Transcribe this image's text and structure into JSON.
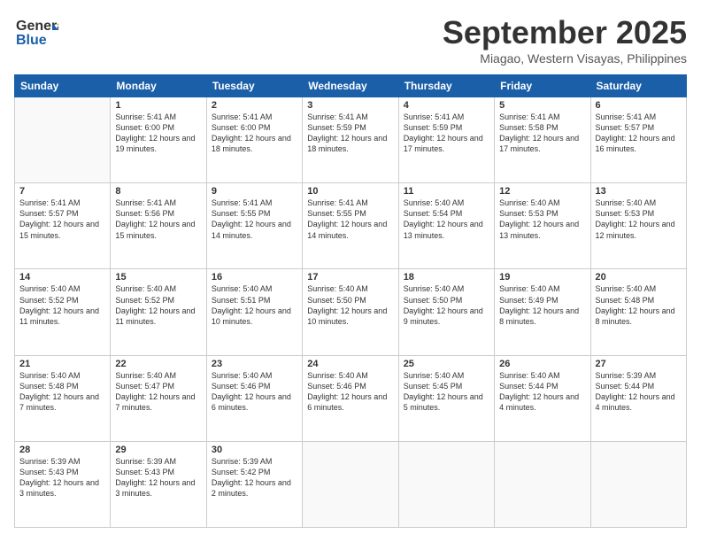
{
  "logo": {
    "line1": "General",
    "line2": "Blue"
  },
  "header": {
    "month": "September 2025",
    "location": "Miagao, Western Visayas, Philippines"
  },
  "weekdays": [
    "Sunday",
    "Monday",
    "Tuesday",
    "Wednesday",
    "Thursday",
    "Friday",
    "Saturday"
  ],
  "weeks": [
    [
      {
        "day": "",
        "sunrise": "",
        "sunset": "",
        "daylight": ""
      },
      {
        "day": "1",
        "sunrise": "Sunrise: 5:41 AM",
        "sunset": "Sunset: 6:00 PM",
        "daylight": "Daylight: 12 hours and 19 minutes."
      },
      {
        "day": "2",
        "sunrise": "Sunrise: 5:41 AM",
        "sunset": "Sunset: 6:00 PM",
        "daylight": "Daylight: 12 hours and 18 minutes."
      },
      {
        "day": "3",
        "sunrise": "Sunrise: 5:41 AM",
        "sunset": "Sunset: 5:59 PM",
        "daylight": "Daylight: 12 hours and 18 minutes."
      },
      {
        "day": "4",
        "sunrise": "Sunrise: 5:41 AM",
        "sunset": "Sunset: 5:59 PM",
        "daylight": "Daylight: 12 hours and 17 minutes."
      },
      {
        "day": "5",
        "sunrise": "Sunrise: 5:41 AM",
        "sunset": "Sunset: 5:58 PM",
        "daylight": "Daylight: 12 hours and 17 minutes."
      },
      {
        "day": "6",
        "sunrise": "Sunrise: 5:41 AM",
        "sunset": "Sunset: 5:57 PM",
        "daylight": "Daylight: 12 hours and 16 minutes."
      }
    ],
    [
      {
        "day": "7",
        "sunrise": "Sunrise: 5:41 AM",
        "sunset": "Sunset: 5:57 PM",
        "daylight": "Daylight: 12 hours and 15 minutes."
      },
      {
        "day": "8",
        "sunrise": "Sunrise: 5:41 AM",
        "sunset": "Sunset: 5:56 PM",
        "daylight": "Daylight: 12 hours and 15 minutes."
      },
      {
        "day": "9",
        "sunrise": "Sunrise: 5:41 AM",
        "sunset": "Sunset: 5:55 PM",
        "daylight": "Daylight: 12 hours and 14 minutes."
      },
      {
        "day": "10",
        "sunrise": "Sunrise: 5:41 AM",
        "sunset": "Sunset: 5:55 PM",
        "daylight": "Daylight: 12 hours and 14 minutes."
      },
      {
        "day": "11",
        "sunrise": "Sunrise: 5:40 AM",
        "sunset": "Sunset: 5:54 PM",
        "daylight": "Daylight: 12 hours and 13 minutes."
      },
      {
        "day": "12",
        "sunrise": "Sunrise: 5:40 AM",
        "sunset": "Sunset: 5:53 PM",
        "daylight": "Daylight: 12 hours and 13 minutes."
      },
      {
        "day": "13",
        "sunrise": "Sunrise: 5:40 AM",
        "sunset": "Sunset: 5:53 PM",
        "daylight": "Daylight: 12 hours and 12 minutes."
      }
    ],
    [
      {
        "day": "14",
        "sunrise": "Sunrise: 5:40 AM",
        "sunset": "Sunset: 5:52 PM",
        "daylight": "Daylight: 12 hours and 11 minutes."
      },
      {
        "day": "15",
        "sunrise": "Sunrise: 5:40 AM",
        "sunset": "Sunset: 5:52 PM",
        "daylight": "Daylight: 12 hours and 11 minutes."
      },
      {
        "day": "16",
        "sunrise": "Sunrise: 5:40 AM",
        "sunset": "Sunset: 5:51 PM",
        "daylight": "Daylight: 12 hours and 10 minutes."
      },
      {
        "day": "17",
        "sunrise": "Sunrise: 5:40 AM",
        "sunset": "Sunset: 5:50 PM",
        "daylight": "Daylight: 12 hours and 10 minutes."
      },
      {
        "day": "18",
        "sunrise": "Sunrise: 5:40 AM",
        "sunset": "Sunset: 5:50 PM",
        "daylight": "Daylight: 12 hours and 9 minutes."
      },
      {
        "day": "19",
        "sunrise": "Sunrise: 5:40 AM",
        "sunset": "Sunset: 5:49 PM",
        "daylight": "Daylight: 12 hours and 8 minutes."
      },
      {
        "day": "20",
        "sunrise": "Sunrise: 5:40 AM",
        "sunset": "Sunset: 5:48 PM",
        "daylight": "Daylight: 12 hours and 8 minutes."
      }
    ],
    [
      {
        "day": "21",
        "sunrise": "Sunrise: 5:40 AM",
        "sunset": "Sunset: 5:48 PM",
        "daylight": "Daylight: 12 hours and 7 minutes."
      },
      {
        "day": "22",
        "sunrise": "Sunrise: 5:40 AM",
        "sunset": "Sunset: 5:47 PM",
        "daylight": "Daylight: 12 hours and 7 minutes."
      },
      {
        "day": "23",
        "sunrise": "Sunrise: 5:40 AM",
        "sunset": "Sunset: 5:46 PM",
        "daylight": "Daylight: 12 hours and 6 minutes."
      },
      {
        "day": "24",
        "sunrise": "Sunrise: 5:40 AM",
        "sunset": "Sunset: 5:46 PM",
        "daylight": "Daylight: 12 hours and 6 minutes."
      },
      {
        "day": "25",
        "sunrise": "Sunrise: 5:40 AM",
        "sunset": "Sunset: 5:45 PM",
        "daylight": "Daylight: 12 hours and 5 minutes."
      },
      {
        "day": "26",
        "sunrise": "Sunrise: 5:40 AM",
        "sunset": "Sunset: 5:44 PM",
        "daylight": "Daylight: 12 hours and 4 minutes."
      },
      {
        "day": "27",
        "sunrise": "Sunrise: 5:39 AM",
        "sunset": "Sunset: 5:44 PM",
        "daylight": "Daylight: 12 hours and 4 minutes."
      }
    ],
    [
      {
        "day": "28",
        "sunrise": "Sunrise: 5:39 AM",
        "sunset": "Sunset: 5:43 PM",
        "daylight": "Daylight: 12 hours and 3 minutes."
      },
      {
        "day": "29",
        "sunrise": "Sunrise: 5:39 AM",
        "sunset": "Sunset: 5:43 PM",
        "daylight": "Daylight: 12 hours and 3 minutes."
      },
      {
        "day": "30",
        "sunrise": "Sunrise: 5:39 AM",
        "sunset": "Sunset: 5:42 PM",
        "daylight": "Daylight: 12 hours and 2 minutes."
      },
      {
        "day": "",
        "sunrise": "",
        "sunset": "",
        "daylight": ""
      },
      {
        "day": "",
        "sunrise": "",
        "sunset": "",
        "daylight": ""
      },
      {
        "day": "",
        "sunrise": "",
        "sunset": "",
        "daylight": ""
      },
      {
        "day": "",
        "sunrise": "",
        "sunset": "",
        "daylight": ""
      }
    ]
  ]
}
